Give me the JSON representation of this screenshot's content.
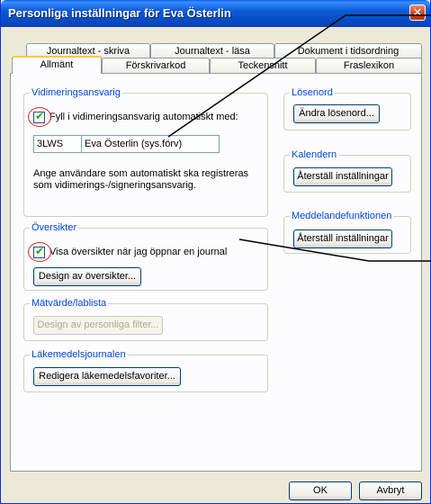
{
  "window": {
    "title": "Personliga inställningar för Eva Österlin",
    "close_glyph": "✕"
  },
  "tabs_row1": [
    {
      "label": "Journaltext - skriva"
    },
    {
      "label": "Journaltext - läsa"
    },
    {
      "label": "Dokument i tidsordning"
    }
  ],
  "tabs_row2": [
    {
      "label": "Allmänt",
      "selected": true
    },
    {
      "label": "Förskrivarkod"
    },
    {
      "label": "Teckensnitt"
    },
    {
      "label": "Fraslexikon"
    }
  ],
  "vidimering": {
    "title": "Vidimeringsansvarig",
    "checkbox_label": "Fyll i vidimeringsansvarig automatiskt med:",
    "checked": true,
    "code_value": "3LWS",
    "name_value": "Eva Österlin (sys.förv)",
    "help_text_line1": "Ange användare som automatiskt ska registreras",
    "help_text_line2": "som vidimerings-/signeringsansvarig."
  },
  "oversikter": {
    "title": "Översikter",
    "checkbox_label": "Visa översikter när jag öppnar en journal",
    "checked": true,
    "design_button": "Design av översikter..."
  },
  "matvarde": {
    "title": "Mätvärde/lablista",
    "design_button": "Design av personliga filter..."
  },
  "lakemedel": {
    "title": "Läkemedelsjournalen",
    "edit_button": "Redigera läkemedelsfavoriter..."
  },
  "losenord": {
    "title": "Lösenord",
    "button": "Ändra lösenord..."
  },
  "kalendern": {
    "title": "Kalendern",
    "button": "Återställ inställningar"
  },
  "meddelande": {
    "title": "Meddelandefunktionen",
    "button": "Återställ inställningar"
  },
  "footer": {
    "ok_label": "OK",
    "cancel_label": "Avbryt"
  },
  "colors": {
    "titlebar": "#0b5bd6",
    "group_title": "#0046d5",
    "annotation": "#e02020",
    "accent_tab": "#ffc83c"
  }
}
